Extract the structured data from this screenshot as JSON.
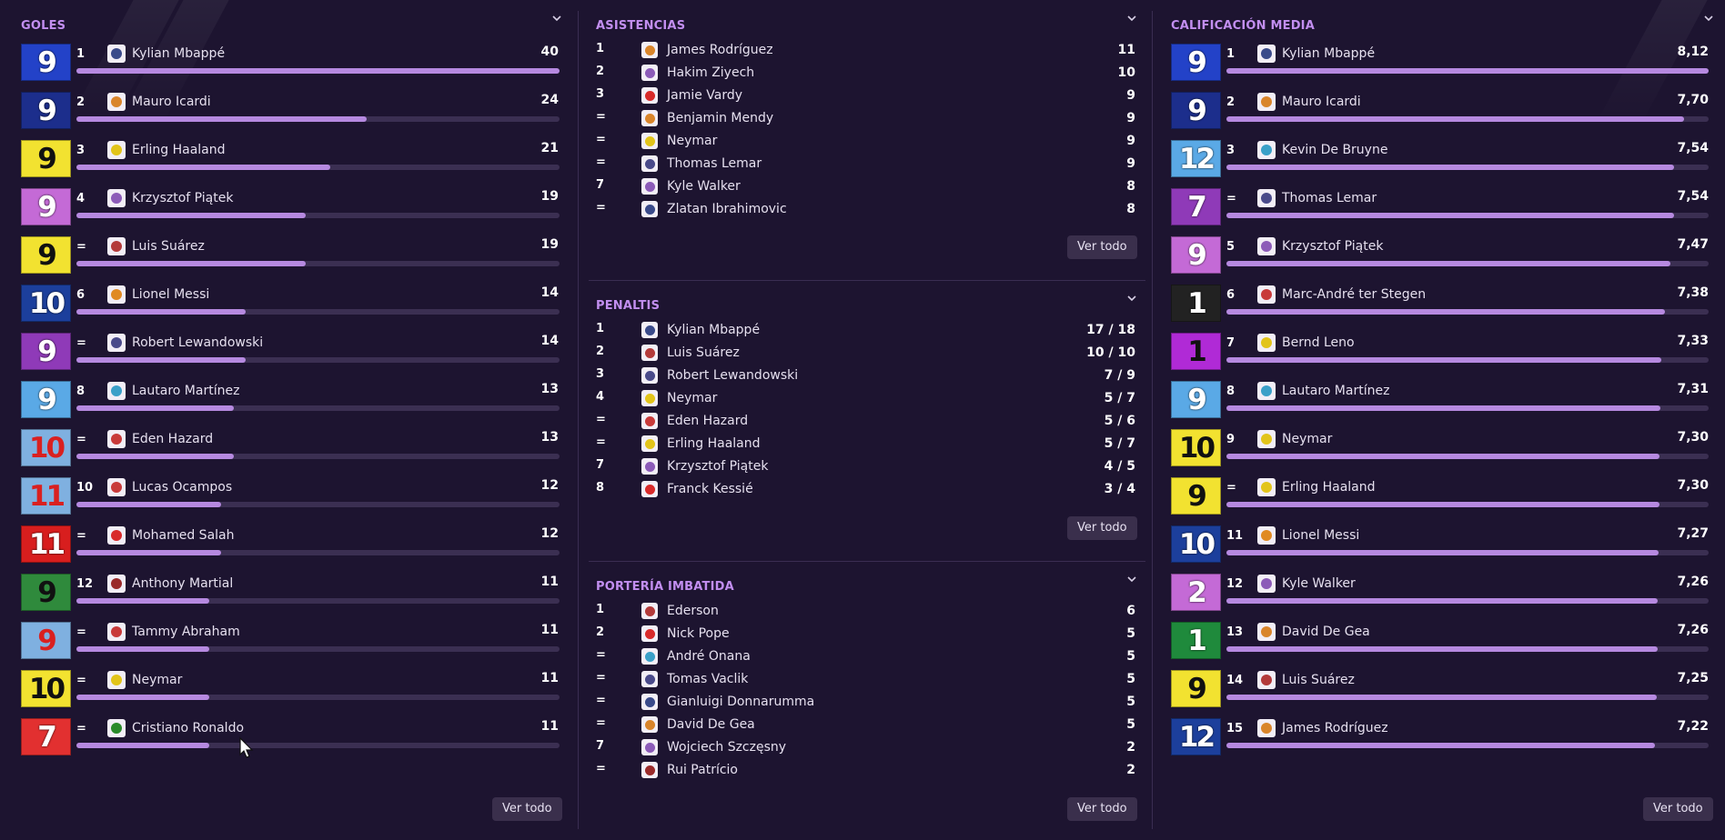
{
  "goles": {
    "title": "GOLES",
    "button": "Ver todo",
    "max": 40,
    "rows": [
      {
        "rank": "1",
        "kit": "9",
        "name": "Kylian Mbappé",
        "value": "40",
        "num": 40,
        "kit_bg": "#2342c8",
        "kit_fg": "#ffffff",
        "club": "#3a4a8a"
      },
      {
        "rank": "2",
        "kit": "9",
        "name": "Mauro Icardi",
        "value": "24",
        "num": 24,
        "kit_bg": "#1c2e8c",
        "kit_fg": "#ffffff",
        "club": "#d9852b"
      },
      {
        "rank": "3",
        "kit": "9",
        "name": "Erling Haaland",
        "value": "21",
        "num": 21,
        "kit_bg": "#f2e230",
        "kit_fg": "#111111",
        "club": "#e2c41a"
      },
      {
        "rank": "4",
        "kit": "9",
        "name": "Krzysztof Piątek",
        "value": "19",
        "num": 19,
        "kit_bg": "#c46ad6",
        "kit_fg": "#ffffff",
        "club": "#8c5bb8"
      },
      {
        "rank": "=",
        "kit": "9",
        "name": "Luis Suárez",
        "value": "19",
        "num": 19,
        "kit_bg": "#f2e230",
        "kit_fg": "#111111",
        "club": "#b33a3a"
      },
      {
        "rank": "6",
        "kit": "10",
        "name": "Lionel Messi",
        "value": "14",
        "num": 14,
        "kit_bg": "#1c3f9c",
        "kit_fg": "#ffffff",
        "club": "#e08a22"
      },
      {
        "rank": "=",
        "kit": "9",
        "name": "Robert Lewandowski",
        "value": "14",
        "num": 14,
        "kit_bg": "#8f3ab8",
        "kit_fg": "#ffffff",
        "club": "#4a4a8a"
      },
      {
        "rank": "8",
        "kit": "9",
        "name": "Lautaro Martínez",
        "value": "13",
        "num": 13,
        "kit_bg": "#5aa9e6",
        "kit_fg": "#ffffff",
        "club": "#3aa0c8"
      },
      {
        "rank": "=",
        "kit": "10",
        "name": "Eden Hazard",
        "value": "13",
        "num": 13,
        "kit_bg": "#7fb0e0",
        "kit_fg": "#d92020",
        "club": "#c83a3a"
      },
      {
        "rank": "10",
        "kit": "11",
        "name": "Lucas Ocampos",
        "value": "12",
        "num": 12,
        "kit_bg": "#7fb0e0",
        "kit_fg": "#d92020",
        "club": "#c83a3a"
      },
      {
        "rank": "=",
        "kit": "11",
        "name": "Mohamed Salah",
        "value": "12",
        "num": 12,
        "kit_bg": "#d81e1e",
        "kit_fg": "#ffffff",
        "club": "#d82a2a"
      },
      {
        "rank": "12",
        "kit": "9",
        "name": "Anthony Martial",
        "value": "11",
        "num": 11,
        "kit_bg": "#2f8a3c",
        "kit_fg": "#111111",
        "club": "#9a2a2a"
      },
      {
        "rank": "=",
        "kit": "9",
        "name": "Tammy Abraham",
        "value": "11",
        "num": 11,
        "kit_bg": "#7fb0e0",
        "kit_fg": "#d92020",
        "club": "#c83a3a"
      },
      {
        "rank": "=",
        "kit": "10",
        "name": "Neymar",
        "value": "11",
        "num": 11,
        "kit_bg": "#f2e230",
        "kit_fg": "#111111",
        "club": "#e2c41a"
      },
      {
        "rank": "=",
        "kit": "7",
        "name": "Cristiano Ronaldo",
        "value": "11",
        "num": 11,
        "kit_bg": "#e23030",
        "kit_fg": "#ffffff",
        "club": "#2a8a2a"
      }
    ]
  },
  "asistencias": {
    "title": "ASISTENCIAS",
    "button": "Ver todo",
    "rows": [
      {
        "rank": "1",
        "name": "James Rodríguez",
        "value": "11",
        "club": "#d9852b"
      },
      {
        "rank": "2",
        "name": "Hakim Ziyech",
        "value": "10",
        "club": "#8c5bb8"
      },
      {
        "rank": "3",
        "name": "Jamie Vardy",
        "value": "9",
        "club": "#d82a2a"
      },
      {
        "rank": "=",
        "name": "Benjamin Mendy",
        "value": "9",
        "club": "#d9852b"
      },
      {
        "rank": "=",
        "name": "Neymar",
        "value": "9",
        "club": "#e2c41a"
      },
      {
        "rank": "=",
        "name": "Thomas Lemar",
        "value": "9",
        "club": "#4a4a8a"
      },
      {
        "rank": "7",
        "name": "Kyle Walker",
        "value": "8",
        "club": "#8c5bb8"
      },
      {
        "rank": "=",
        "name": "Zlatan Ibrahimovic",
        "value": "8",
        "club": "#3a4a8a"
      }
    ]
  },
  "penaltis": {
    "title": "PENALTIS",
    "button": "Ver todo",
    "rows": [
      {
        "rank": "1",
        "name": "Kylian Mbappé",
        "value": "17 / 18",
        "club": "#3a4a8a"
      },
      {
        "rank": "2",
        "name": "Luis Suárez",
        "value": "10 / 10",
        "club": "#b33a3a"
      },
      {
        "rank": "3",
        "name": "Robert Lewandowski",
        "value": "7 / 9",
        "club": "#4a4a8a"
      },
      {
        "rank": "4",
        "name": "Neymar",
        "value": "5 / 7",
        "club": "#e2c41a"
      },
      {
        "rank": "=",
        "name": "Eden Hazard",
        "value": "5 / 6",
        "club": "#c83a3a"
      },
      {
        "rank": "=",
        "name": "Erling Haaland",
        "value": "5 / 7",
        "club": "#e2c41a"
      },
      {
        "rank": "7",
        "name": "Krzysztof Piątek",
        "value": "4 / 5",
        "club": "#8c5bb8"
      },
      {
        "rank": "8",
        "name": "Franck Kessié",
        "value": "3 / 4",
        "club": "#d82a2a"
      }
    ]
  },
  "porteria": {
    "title": "PORTERÍA IMBATIDA",
    "button": "Ver todo",
    "rows": [
      {
        "rank": "1",
        "name": "Ederson",
        "value": "6",
        "club": "#b33a3a"
      },
      {
        "rank": "2",
        "name": "Nick Pope",
        "value": "5",
        "club": "#d82a2a"
      },
      {
        "rank": "=",
        "name": "André Onana",
        "value": "5",
        "club": "#3aa0c8"
      },
      {
        "rank": "=",
        "name": "Tomas Vaclik",
        "value": "5",
        "club": "#4a4a8a"
      },
      {
        "rank": "=",
        "name": "Gianluigi Donnarumma",
        "value": "5",
        "club": "#3a4a8a"
      },
      {
        "rank": "=",
        "name": "David De Gea",
        "value": "5",
        "club": "#d9852b"
      },
      {
        "rank": "7",
        "name": "Wojciech Szczęsny",
        "value": "2",
        "club": "#8c5bb8"
      },
      {
        "rank": "=",
        "name": "Rui Patrício",
        "value": "2",
        "club": "#9a2a2a"
      }
    ]
  },
  "calificacion": {
    "title": "CALIFICACIÓN MEDIA",
    "button": "Ver todo",
    "max": 8.12,
    "rows": [
      {
        "rank": "1",
        "kit": "9",
        "name": "Kylian Mbappé",
        "value": "8,12",
        "num": 8.12,
        "kit_bg": "#2342c8",
        "kit_fg": "#ffffff",
        "club": "#3a4a8a"
      },
      {
        "rank": "2",
        "kit": "9",
        "name": "Mauro Icardi",
        "value": "7,70",
        "num": 7.7,
        "kit_bg": "#1c2e8c",
        "kit_fg": "#ffffff",
        "club": "#d9852b"
      },
      {
        "rank": "3",
        "kit": "12",
        "name": "Kevin De Bruyne",
        "value": "7,54",
        "num": 7.54,
        "kit_bg": "#5aa9e6",
        "kit_fg": "#ffffff",
        "club": "#3aa0c8"
      },
      {
        "rank": "=",
        "kit": "7",
        "name": "Thomas Lemar",
        "value": "7,54",
        "num": 7.54,
        "kit_bg": "#8f3ab8",
        "kit_fg": "#ffffff",
        "club": "#4a4a8a"
      },
      {
        "rank": "5",
        "kit": "9",
        "name": "Krzysztof Piątek",
        "value": "7,47",
        "num": 7.47,
        "kit_bg": "#c46ad6",
        "kit_fg": "#ffffff",
        "club": "#8c5bb8"
      },
      {
        "rank": "6",
        "kit": "1",
        "name": "Marc-André ter Stegen",
        "value": "7,38",
        "num": 7.38,
        "kit_bg": "#222222",
        "kit_fg": "#ffffff",
        "club": "#c83a3a"
      },
      {
        "rank": "7",
        "kit": "1",
        "name": "Bernd Leno",
        "value": "7,33",
        "num": 7.33,
        "kit_bg": "#b02ad6",
        "kit_fg": "#111111",
        "club": "#e2c41a"
      },
      {
        "rank": "8",
        "kit": "9",
        "name": "Lautaro Martínez",
        "value": "7,31",
        "num": 7.31,
        "kit_bg": "#5aa9e6",
        "kit_fg": "#ffffff",
        "club": "#3aa0c8"
      },
      {
        "rank": "9",
        "kit": "10",
        "name": "Neymar",
        "value": "7,30",
        "num": 7.3,
        "kit_bg": "#f2e230",
        "kit_fg": "#111111",
        "club": "#e2c41a"
      },
      {
        "rank": "=",
        "kit": "9",
        "name": "Erling Haaland",
        "value": "7,30",
        "num": 7.3,
        "kit_bg": "#f2e230",
        "kit_fg": "#111111",
        "club": "#e2c41a"
      },
      {
        "rank": "11",
        "kit": "10",
        "name": "Lionel Messi",
        "value": "7,27",
        "num": 7.27,
        "kit_bg": "#1c3f9c",
        "kit_fg": "#ffffff",
        "club": "#e08a22"
      },
      {
        "rank": "12",
        "kit": "2",
        "name": "Kyle Walker",
        "value": "7,26",
        "num": 7.26,
        "kit_bg": "#c46ad6",
        "kit_fg": "#ffffff",
        "club": "#8c5bb8"
      },
      {
        "rank": "13",
        "kit": "1",
        "name": "David De Gea",
        "value": "7,26",
        "num": 7.26,
        "kit_bg": "#1f8a3c",
        "kit_fg": "#ffffff",
        "club": "#d9852b"
      },
      {
        "rank": "14",
        "kit": "9",
        "name": "Luis Suárez",
        "value": "7,25",
        "num": 7.25,
        "kit_bg": "#f2e230",
        "kit_fg": "#111111",
        "club": "#b33a3a"
      },
      {
        "rank": "15",
        "kit": "12",
        "name": "James Rodríguez",
        "value": "7,22",
        "num": 7.22,
        "kit_bg": "#1c3f9c",
        "kit_fg": "#ffffff",
        "club": "#d9852b"
      }
    ]
  },
  "colors": {
    "background": "#1d1430",
    "accent_title": "#c28ef0",
    "bar_fill": "#b689e0",
    "bar_track": "#3b2f52",
    "button_bg": "#3a2f4c"
  }
}
